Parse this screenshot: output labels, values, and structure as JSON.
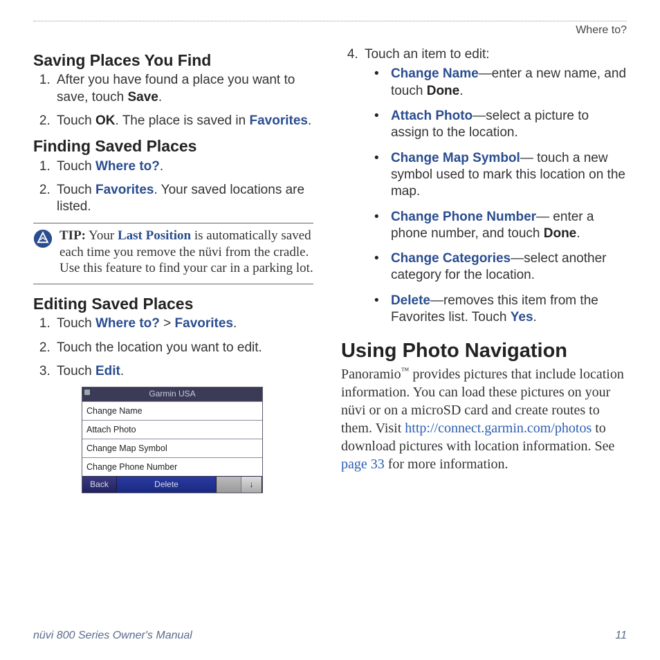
{
  "running_head": "Where to?",
  "left": {
    "saving": {
      "heading": "Saving Places You Find",
      "step1_a": "After you have found a place you want to save, touch ",
      "step1_save": "Save",
      "step1_b": ".",
      "step2_a": "Touch ",
      "step2_ok": "OK",
      "step2_b": ". The place is saved in ",
      "step2_fav": "Favorites",
      "step2_c": "."
    },
    "finding": {
      "heading": "Finding Saved Places",
      "step1_a": "Touch ",
      "step1_where": "Where to?",
      "step1_b": ".",
      "step2_a": "Touch ",
      "step2_fav": "Favorites",
      "step2_b": ". Your saved locations are listed."
    },
    "tip": {
      "label": "TIP:",
      "a": " Your ",
      "lp": "Last Position",
      "b": " is automatically saved each time you remove the nüvi from the cradle. Use this feature to find your car in a parking lot."
    },
    "editing": {
      "heading": "Editing Saved Places",
      "step1_a": "Touch ",
      "step1_where": "Where to?",
      "step1_gt": " > ",
      "step1_fav": "Favorites",
      "step1_b": ".",
      "step2": "Touch the location you want to edit.",
      "step3_a": "Touch ",
      "step3_edit": "Edit",
      "step3_b": "."
    },
    "device": {
      "title": "Garmin USA",
      "rows": [
        "Change Name",
        "Attach Photo",
        "Change Map Symbol",
        "Change Phone Number"
      ],
      "back": "Back",
      "delete": "Delete",
      "down": "↓"
    }
  },
  "right": {
    "step4": "Touch an item to edit:",
    "items": {
      "cn": {
        "kw": "Change Name",
        "rest": "—enter a new name, and touch ",
        "done": "Done",
        "end": "."
      },
      "ap": {
        "kw": "Attach Photo",
        "rest": "—select a picture to assign to the location."
      },
      "cms": {
        "kw": "Change Map Symbol",
        "rest": "— touch a new symbol used to mark this location on the map."
      },
      "cpn": {
        "kw": "Change Phone Number",
        "rest": "— enter a phone number, and touch ",
        "done": "Done",
        "end": "."
      },
      "cc": {
        "kw": "Change Categories",
        "rest": "—select another category for the location."
      },
      "del": {
        "kw": "Delete",
        "rest": "—removes this item from the Favorites list. Touch ",
        "yes": "Yes",
        "end": "."
      }
    },
    "photo": {
      "heading": "Using Photo Navigation",
      "p_a": "Panoramio",
      "tm": "™",
      "p_b": " provides pictures that include location information. You can load these pictures on your nüvi or on a microSD card and create routes to them. Visit ",
      "url": "http://connect.garmin.com/photos",
      "p_c": " to download pictures with location information. See ",
      "page": "page 33",
      "p_d": " for more information."
    }
  },
  "footer": {
    "left": "nüvi 800 Series Owner's Manual",
    "right": "11"
  }
}
